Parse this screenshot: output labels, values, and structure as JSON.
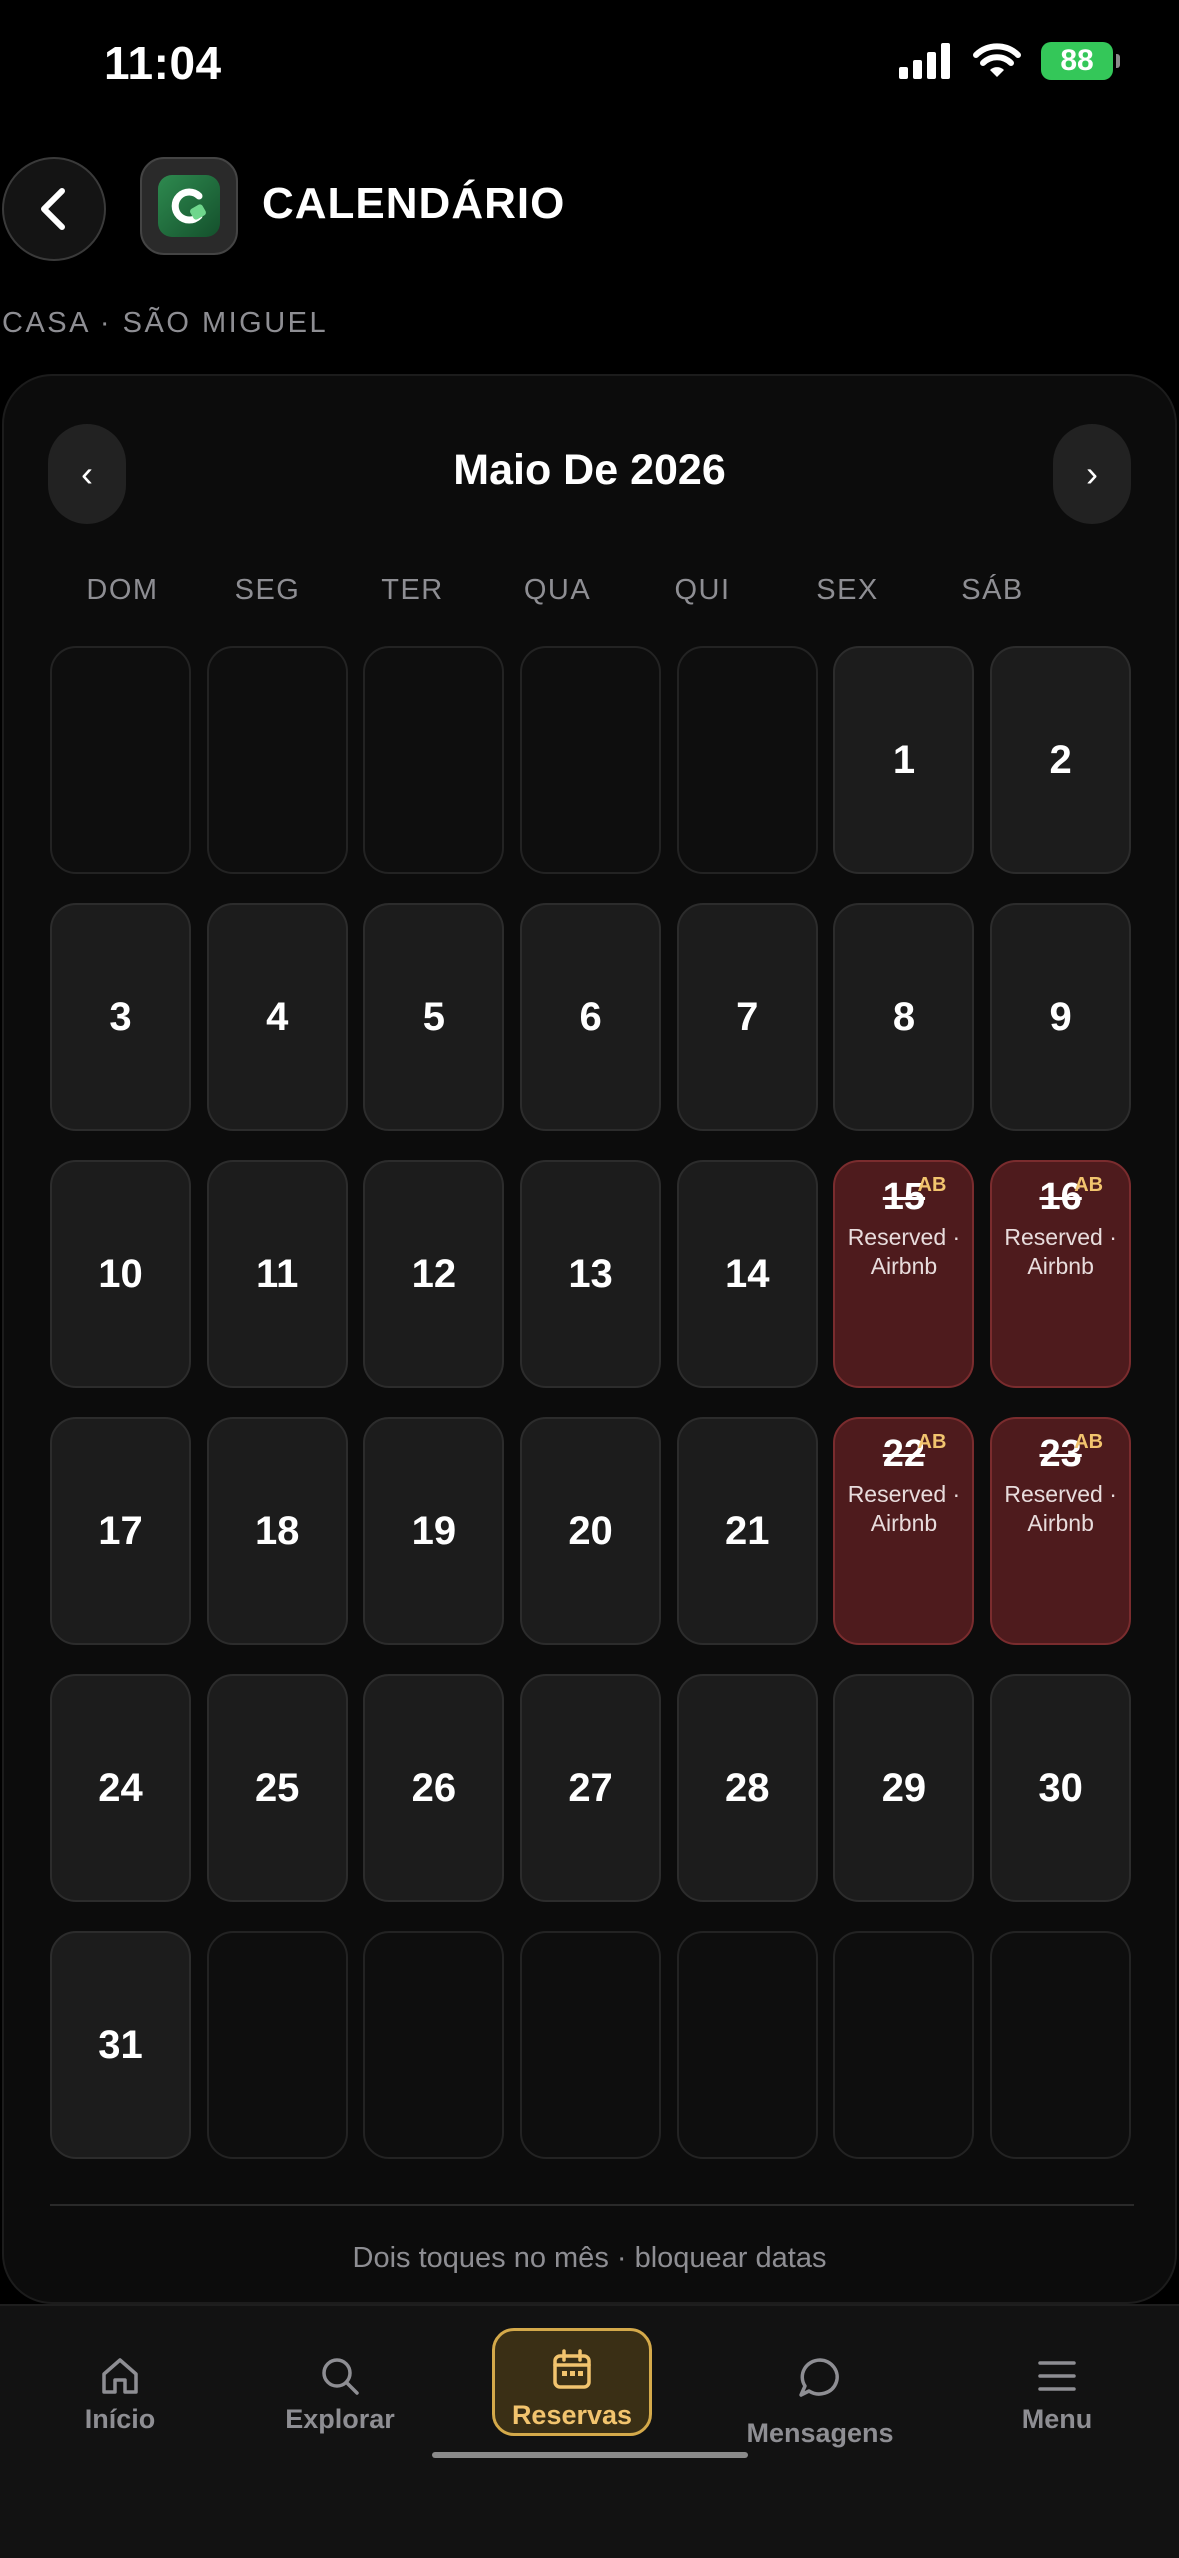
{
  "status": {
    "time": "11:04",
    "battery": "88"
  },
  "header": {
    "title": "CALENDÁRIO",
    "subtitle": "CASA · SÃO MIGUEL"
  },
  "calendar": {
    "month_title": "Maio De 2026",
    "prev_label": "‹",
    "next_label": "›",
    "weekdays": [
      "DOM",
      "SEG",
      "TER",
      "QUA",
      "QUI",
      "SEX",
      "SÁB"
    ],
    "reserved_label": "Reserved · Airbnb",
    "ab_tag": "AB",
    "reserved_days": [
      15,
      16,
      22,
      23
    ],
    "days": [
      "",
      "",
      "",
      "",
      "",
      "1",
      "2",
      "3",
      "4",
      "5",
      "6",
      "7",
      "8",
      "9",
      "10",
      "11",
      "12",
      "13",
      "14",
      "15",
      "16",
      "17",
      "18",
      "19",
      "20",
      "21",
      "22",
      "23",
      "24",
      "25",
      "26",
      "27",
      "28",
      "29",
      "30",
      "31",
      "",
      "",
      "",
      "",
      "",
      ""
    ],
    "hint": "Dois toques no mês · bloquear datas"
  },
  "tabs": [
    {
      "label": "Início",
      "icon": "home-icon"
    },
    {
      "label": "Explorar",
      "icon": "search-icon"
    },
    {
      "label": "Reservas",
      "icon": "calendar-icon",
      "active": true
    },
    {
      "label": "Mensagens",
      "icon": "message-icon"
    },
    {
      "label": "Menu",
      "icon": "menu-icon"
    }
  ],
  "colors": {
    "accent": "#f2c46e",
    "reserved_bg": "#4e1b1d",
    "battery": "#34c759"
  }
}
